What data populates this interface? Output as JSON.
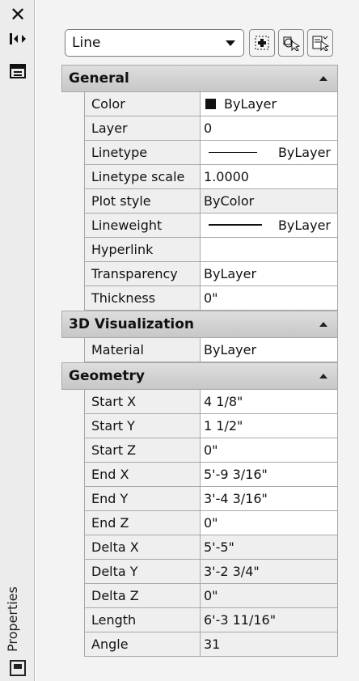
{
  "side_title": "Properties",
  "select": {
    "value": "Line"
  },
  "sections": [
    {
      "title": "General",
      "rows": [
        {
          "label": "Color",
          "value": "ByLayer"
        },
        {
          "label": "Layer",
          "value": "0"
        },
        {
          "label": "Linetype",
          "value": "ByLayer"
        },
        {
          "label": "Linetype scale",
          "value": "1.0000"
        },
        {
          "label": "Plot style",
          "value": "ByColor"
        },
        {
          "label": "Lineweight",
          "value": "ByLayer"
        },
        {
          "label": "Hyperlink",
          "value": ""
        },
        {
          "label": "Transparency",
          "value": "ByLayer"
        },
        {
          "label": "Thickness",
          "value": "0\""
        }
      ]
    },
    {
      "title": "3D Visualization",
      "rows": [
        {
          "label": "Material",
          "value": "ByLayer"
        }
      ]
    },
    {
      "title": "Geometry",
      "rows": [
        {
          "label": "Start X",
          "value": "4 1/8\""
        },
        {
          "label": "Start Y",
          "value": "1 1/2\""
        },
        {
          "label": "Start Z",
          "value": "0\""
        },
        {
          "label": "End X",
          "value": "5'-9 3/16\""
        },
        {
          "label": "End Y",
          "value": "3'-4 3/16\""
        },
        {
          "label": "End Z",
          "value": "0\""
        },
        {
          "label": "Delta X",
          "value": "5'-5\""
        },
        {
          "label": "Delta Y",
          "value": "3'-2 3/4\""
        },
        {
          "label": "Delta Z",
          "value": "0\""
        },
        {
          "label": "Length",
          "value": "6'-3 11/16\""
        },
        {
          "label": "Angle",
          "value": "31"
        }
      ]
    }
  ]
}
